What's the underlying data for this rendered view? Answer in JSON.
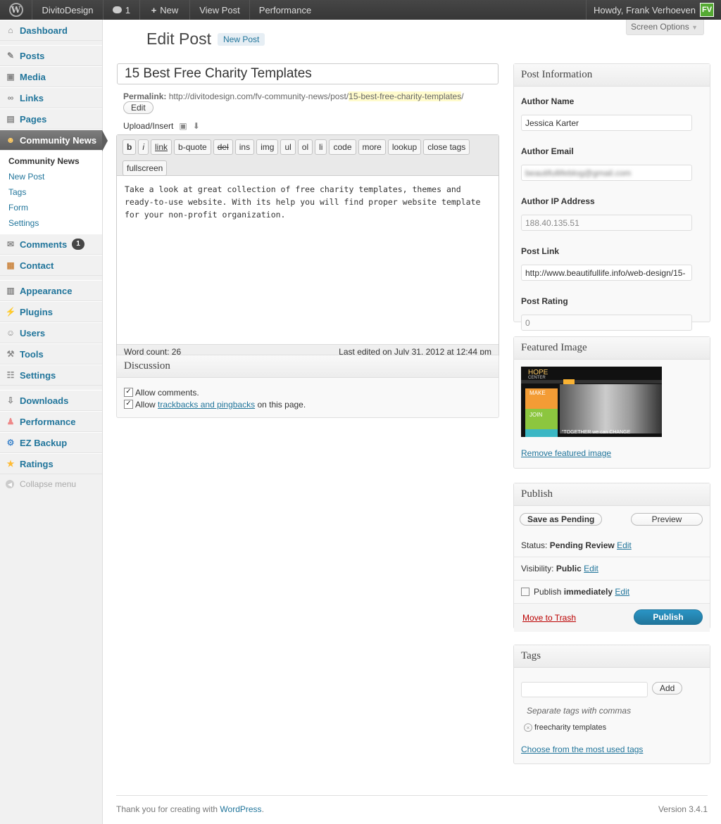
{
  "adminbar": {
    "site_name": "DivitoDesign",
    "comment_count": "1",
    "new_label": "New",
    "view_post": "View Post",
    "performance": "Performance",
    "howdy": "Howdy, Frank Verhoeven",
    "avatar_initials": "FV"
  },
  "sidebar": {
    "dashboard": "Dashboard",
    "posts": "Posts",
    "media": "Media",
    "links": "Links",
    "pages": "Pages",
    "community_news": "Community News",
    "submenu": [
      "Community News",
      "New Post",
      "Tags",
      "Form",
      "Settings"
    ],
    "comments": "Comments",
    "comments_badge": "1",
    "contact": "Contact",
    "appearance": "Appearance",
    "plugins": "Plugins",
    "users": "Users",
    "tools": "Tools",
    "settings": "Settings",
    "downloads": "Downloads",
    "performance": "Performance",
    "ez_backup": "EZ Backup",
    "ratings": "Ratings",
    "collapse": "Collapse menu"
  },
  "header": {
    "screen_options": "Screen Options",
    "title": "Edit Post",
    "add_new": "New Post"
  },
  "post": {
    "title": "15 Best Free Charity Templates",
    "permalink_label": "Permalink:",
    "permalink_base": "http://divitodesign.com/fv-community-news/post/",
    "permalink_slug": "15-best-free-charity-templates",
    "permalink_end": "/",
    "edit_label": "Edit",
    "upload_insert": "Upload/Insert",
    "quicktags": [
      "b",
      "i",
      "link",
      "b-quote",
      "del",
      "ins",
      "img",
      "ul",
      "ol",
      "li",
      "code",
      "more",
      "lookup",
      "close tags",
      "fullscreen"
    ],
    "content": "Take a look at great collection of free charity templates, themes and ready-to-use website. With its help you will find proper website template for your non-profit organization.",
    "word_count": "Word count: 26",
    "last_edited": "Last edited on July 31, 2012 at 12:44 pm"
  },
  "discussion": {
    "title": "Discussion",
    "allow_comments": "Allow comments.",
    "allow_prefix": "Allow",
    "trackbacks_link": "trackbacks and pingbacks",
    "allow_suffix": "on this page."
  },
  "post_info": {
    "title": "Post Information",
    "author_name_label": "Author Name",
    "author_name": "Jessica Karter",
    "author_email_label": "Author Email",
    "author_email": "beautifullifeblog@gmail.com",
    "author_ip_label": "Author IP Address",
    "author_ip": "188.40.135.51",
    "post_link_label": "Post Link",
    "post_link": "http://www.beautifullife.info/web-design/15-",
    "post_rating_label": "Post Rating",
    "post_rating": "0"
  },
  "featured": {
    "title": "Featured Image",
    "remove_link": "Remove featured image",
    "image_texts": [
      "HOPE",
      "CENTER",
      "MAKE",
      "JOIN",
      "\"TOGETHER we can CHANGE"
    ]
  },
  "publish": {
    "title": "Publish",
    "save_pending": "Save as Pending",
    "preview": "Preview",
    "status_label": "Status:",
    "status_value": "Pending Review",
    "visibility_label": "Visibility:",
    "visibility_value": "Public",
    "publish_label": "Publish",
    "publish_value": "immediately",
    "edit": "Edit",
    "trash": "Move to Trash",
    "publish_button": "Publish"
  },
  "tags": {
    "title": "Tags",
    "add_button": "Add",
    "hint": "Separate tags with commas",
    "tag": "freecharity templates",
    "most_used": "Choose from the most used tags"
  },
  "footer": {
    "thanks_prefix": "Thank you for creating with",
    "wordpress": "WordPress",
    "version": "Version 3.4.1"
  }
}
